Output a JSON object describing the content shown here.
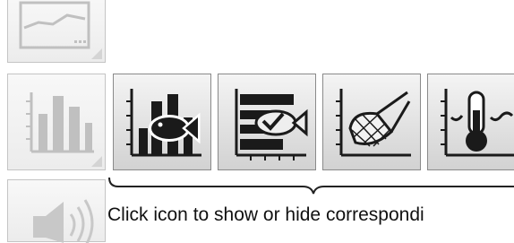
{
  "side_panel": [
    {
      "name": "chart-view-icon",
      "state": "faded"
    },
    {
      "name": "bar-graph-icon",
      "state": "faded"
    },
    {
      "name": "speaker-icon",
      "state": "faded"
    }
  ],
  "overlay_buttons": [
    {
      "name": "fish-histogram-icon"
    },
    {
      "name": "fish-id-icon"
    },
    {
      "name": "trawl-net-icon"
    },
    {
      "name": "water-temperature-icon"
    }
  ],
  "hint": {
    "text": "Click icon to show or hide correspondi"
  },
  "colors": {
    "icon_dark": "#1a1a1a",
    "icon_faded": "#c0c0c0",
    "tile_border": "#8a8a8a",
    "bracket": "#222222"
  }
}
